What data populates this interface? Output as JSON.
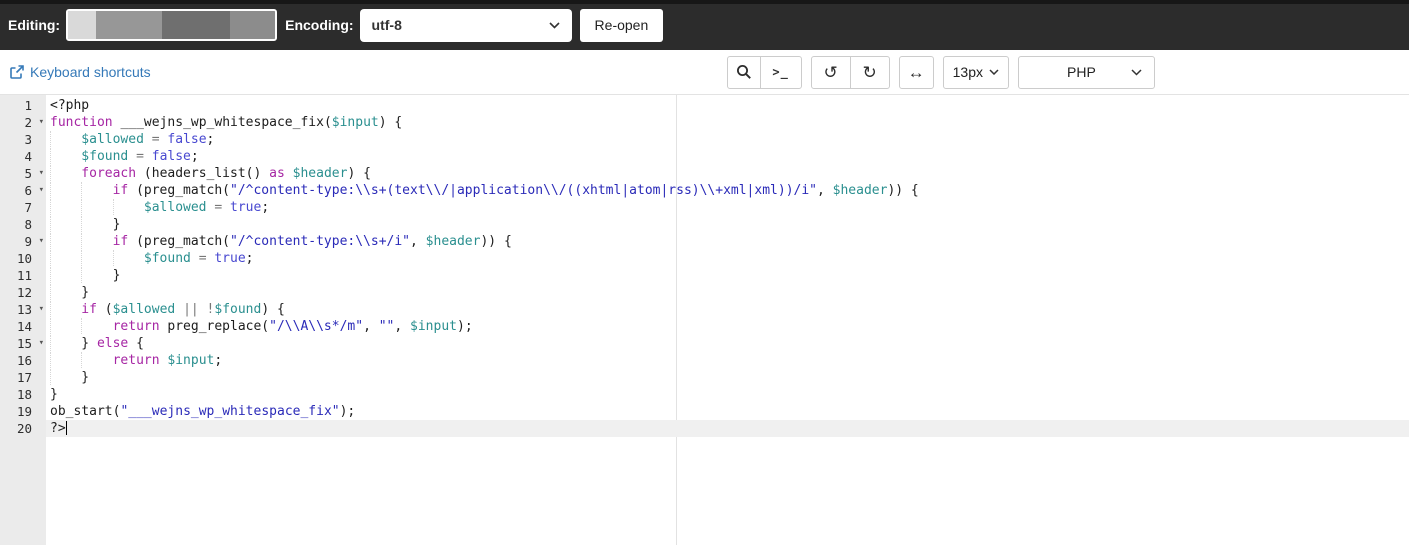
{
  "topbar": {
    "editing_label": "Editing:",
    "encoding_label": "Encoding:",
    "encoding_value": "utf-8",
    "reopen_label": "Re-open"
  },
  "toolbar": {
    "keyboard_shortcuts_label": "Keyboard shortcuts",
    "font_size_value": "13px",
    "language_value": "PHP",
    "icons": {
      "terminal_glyph": ">_",
      "undo_glyph": "↺",
      "redo_glyph": "↻",
      "wrap_glyph": "↔"
    }
  },
  "colors": {
    "topbar_bg": "#2c2c2c",
    "link_blue": "#3579b8",
    "gutter_bg": "#ebebeb",
    "active_line_bg": "#f0f0f0",
    "keyword": "#a626a4",
    "variable": "#2a8f8f",
    "atom": "#4848d0",
    "string": "#2a2ab8",
    "operator": "#777777"
  },
  "editor": {
    "fold_glyph": "▾",
    "ruler_column": 80,
    "lines": [
      {
        "n": 1,
        "indent": 0,
        "seg": [
          {
            "t": "<?php"
          }
        ]
      },
      {
        "n": 2,
        "indent": 0,
        "fold": true,
        "seg": [
          {
            "t": "function",
            "c": "k"
          },
          {
            "t": " ___wejns_wp_whitespace_fix("
          },
          {
            "t": "$input",
            "c": "v"
          },
          {
            "t": ") {"
          }
        ]
      },
      {
        "n": 3,
        "indent": 4,
        "seg": [
          {
            "t": "$allowed",
            "c": "v"
          },
          {
            "t": " "
          },
          {
            "t": "=",
            "c": "o"
          },
          {
            "t": " "
          },
          {
            "t": "false",
            "c": "a"
          },
          {
            "t": ";"
          }
        ]
      },
      {
        "n": 4,
        "indent": 4,
        "seg": [
          {
            "t": "$found",
            "c": "v"
          },
          {
            "t": " "
          },
          {
            "t": "=",
            "c": "o"
          },
          {
            "t": " "
          },
          {
            "t": "false",
            "c": "a"
          },
          {
            "t": ";"
          }
        ]
      },
      {
        "n": 5,
        "indent": 4,
        "fold": true,
        "seg": [
          {
            "t": "foreach",
            "c": "k"
          },
          {
            "t": " (headers_list() "
          },
          {
            "t": "as",
            "c": "k"
          },
          {
            "t": " "
          },
          {
            "t": "$header",
            "c": "v"
          },
          {
            "t": ") {"
          }
        ]
      },
      {
        "n": 6,
        "indent": 8,
        "fold": true,
        "seg": [
          {
            "t": "if",
            "c": "k"
          },
          {
            "t": " (preg_match("
          },
          {
            "t": "\"/^content-type:\\\\s+(text\\\\/|application\\\\/((xhtml|atom|rss)\\\\+xml|xml))/i\"",
            "c": "s"
          },
          {
            "t": ", "
          },
          {
            "t": "$header",
            "c": "v"
          },
          {
            "t": ")) {"
          }
        ]
      },
      {
        "n": 7,
        "indent": 12,
        "seg": [
          {
            "t": "$allowed",
            "c": "v"
          },
          {
            "t": " "
          },
          {
            "t": "=",
            "c": "o"
          },
          {
            "t": " "
          },
          {
            "t": "true",
            "c": "a"
          },
          {
            "t": ";"
          }
        ]
      },
      {
        "n": 8,
        "indent": 8,
        "seg": [
          {
            "t": "}"
          }
        ]
      },
      {
        "n": 9,
        "indent": 8,
        "fold": true,
        "seg": [
          {
            "t": "if",
            "c": "k"
          },
          {
            "t": " (preg_match("
          },
          {
            "t": "\"/^content-type:\\\\s+/i\"",
            "c": "s"
          },
          {
            "t": ", "
          },
          {
            "t": "$header",
            "c": "v"
          },
          {
            "t": ")) {"
          }
        ]
      },
      {
        "n": 10,
        "indent": 12,
        "seg": [
          {
            "t": "$found",
            "c": "v"
          },
          {
            "t": " "
          },
          {
            "t": "=",
            "c": "o"
          },
          {
            "t": " "
          },
          {
            "t": "true",
            "c": "a"
          },
          {
            "t": ";"
          }
        ]
      },
      {
        "n": 11,
        "indent": 8,
        "seg": [
          {
            "t": "}"
          }
        ]
      },
      {
        "n": 12,
        "indent": 4,
        "seg": [
          {
            "t": "}"
          }
        ]
      },
      {
        "n": 13,
        "indent": 4,
        "fold": true,
        "seg": [
          {
            "t": "if",
            "c": "k"
          },
          {
            "t": " ("
          },
          {
            "t": "$allowed",
            "c": "v"
          },
          {
            "t": " "
          },
          {
            "t": "||",
            "c": "o"
          },
          {
            "t": " "
          },
          {
            "t": "!",
            "c": "o"
          },
          {
            "t": "$found",
            "c": "v"
          },
          {
            "t": ") {"
          }
        ]
      },
      {
        "n": 14,
        "indent": 8,
        "seg": [
          {
            "t": "return",
            "c": "k"
          },
          {
            "t": " preg_replace("
          },
          {
            "t": "\"/\\\\A\\\\s*/m\"",
            "c": "s"
          },
          {
            "t": ", "
          },
          {
            "t": "\"\"",
            "c": "s"
          },
          {
            "t": ", "
          },
          {
            "t": "$input",
            "c": "v"
          },
          {
            "t": ");"
          }
        ]
      },
      {
        "n": 15,
        "indent": 4,
        "fold": true,
        "seg": [
          {
            "t": "} "
          },
          {
            "t": "else",
            "c": "k"
          },
          {
            "t": " {"
          }
        ]
      },
      {
        "n": 16,
        "indent": 8,
        "seg": [
          {
            "t": "return",
            "c": "k"
          },
          {
            "t": " "
          },
          {
            "t": "$input",
            "c": "v"
          },
          {
            "t": ";"
          }
        ]
      },
      {
        "n": 17,
        "indent": 4,
        "seg": [
          {
            "t": "}"
          }
        ]
      },
      {
        "n": 18,
        "indent": 0,
        "seg": [
          {
            "t": "}"
          }
        ]
      },
      {
        "n": 19,
        "indent": 0,
        "seg": [
          {
            "t": "ob_start("
          },
          {
            "t": "\"___wejns_wp_whitespace_fix\"",
            "c": "s"
          },
          {
            "t": ");"
          }
        ]
      },
      {
        "n": 20,
        "indent": 0,
        "active": true,
        "cursor": true,
        "seg": [
          {
            "t": "?>"
          }
        ]
      }
    ]
  }
}
